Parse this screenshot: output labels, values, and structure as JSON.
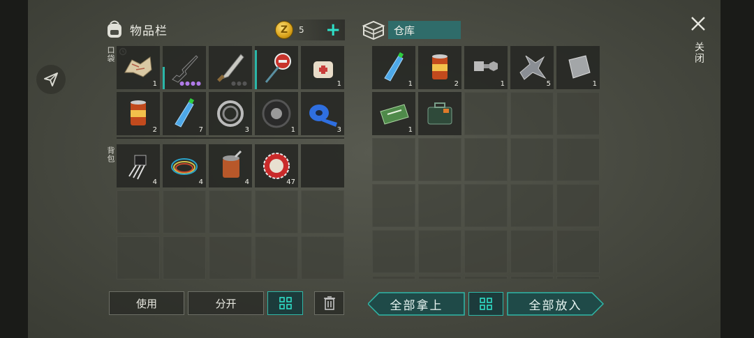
{
  "inventory": {
    "title": "物品栏",
    "coins": "5",
    "pockets_label": "口袋",
    "backpack_label": "背包",
    "pockets": [
      {
        "icon": "map-icon",
        "qty": "1"
      },
      {
        "icon": "rifle-icon",
        "qty": "",
        "durability": true,
        "dots": "purple"
      },
      {
        "icon": "machete-icon",
        "qty": "",
        "dots": "grey"
      },
      {
        "icon": "stop-sign-icon",
        "qty": "",
        "durability": true
      },
      {
        "icon": "bandage-icon",
        "qty": "1"
      },
      {
        "icon": "food-can-icon",
        "qty": "2"
      },
      {
        "icon": "water-bottle-icon",
        "qty": "7"
      },
      {
        "icon": "bearing-icon",
        "qty": "3"
      },
      {
        "icon": "tire-icon",
        "qty": "1"
      },
      {
        "icon": "tape-icon",
        "qty": "3"
      }
    ],
    "backpack": [
      {
        "icon": "transistor-icon",
        "qty": "4"
      },
      {
        "icon": "wires-icon",
        "qty": "4"
      },
      {
        "icon": "open-can-icon",
        "qty": "4"
      },
      {
        "icon": "bottle-cap-icon",
        "qty": "47"
      }
    ],
    "buttons": {
      "use": "使用",
      "split": "分开"
    }
  },
  "warehouse": {
    "title": "仓库",
    "items": [
      {
        "icon": "water-bottle-icon",
        "qty": "1"
      },
      {
        "icon": "food-can-icon",
        "qty": "2"
      },
      {
        "icon": "bolt-nut-icon",
        "qty": "1"
      },
      {
        "icon": "metal-scrap-icon",
        "qty": "5"
      },
      {
        "icon": "metal-plate-icon",
        "qty": "1"
      },
      {
        "icon": "ration-coupon-icon",
        "qty": "1"
      },
      {
        "icon": "toolbox-icon",
        "qty": ""
      }
    ],
    "buttons": {
      "take_all": "全部拿上",
      "put_all": "全部放入"
    }
  },
  "close_label": "关闭",
  "colors": {
    "accent": "#2fb8a8",
    "panel": "#474940"
  }
}
